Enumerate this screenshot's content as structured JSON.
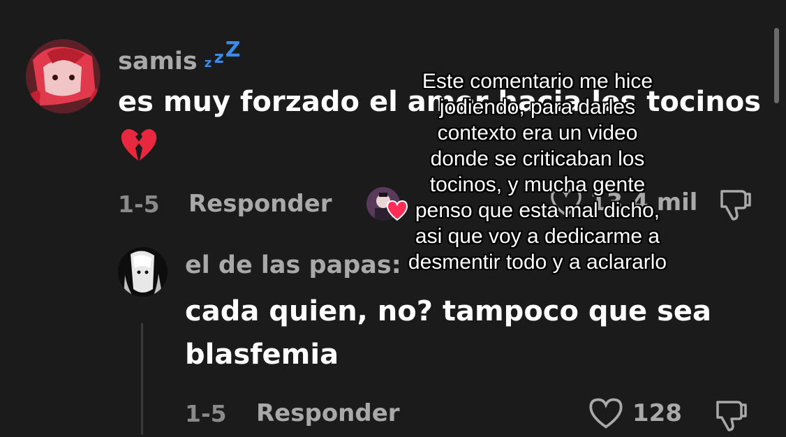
{
  "comment": {
    "username": "samis",
    "username_suffix": "zᶻᶻ",
    "text": "es muy forzado el amor hacia los tocinos",
    "emoji": "💔",
    "date": "1-5",
    "reply_label": "Responder",
    "like_count": "13.4 mil"
  },
  "reply": {
    "username": "el de las papas:",
    "text": "cada quien, no? tampoco que sea blasfemia",
    "date": "1-5",
    "reply_label": "Responder",
    "like_count": "128"
  },
  "overlay_caption": "Este comentario me hice jodiendo, para darles contexto era un video donde se criticaban los tocinos, y mucha gente penso que esta mal dicho, asi que voy a dedicarme a desmentir todo y a aclararlo",
  "colors": {
    "background": "#1b1b1b",
    "heart_badge": "#ff2d55",
    "zzz": "#3a8be8"
  },
  "icons": {
    "like": "heart-outline-icon",
    "dislike": "thumbs-down-icon",
    "creator_liked": "heart-icon"
  }
}
